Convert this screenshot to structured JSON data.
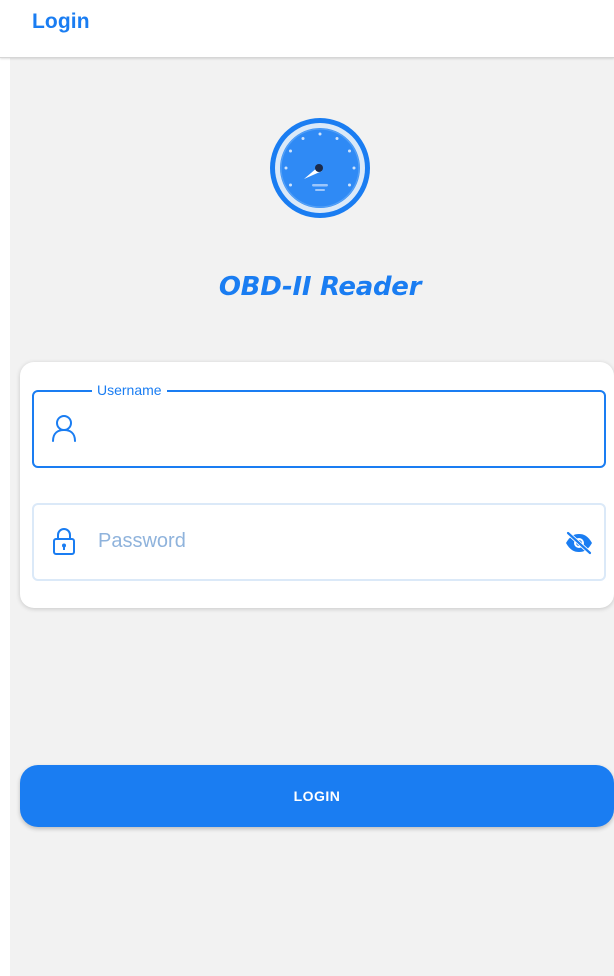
{
  "app_bar": {
    "title": "Login"
  },
  "brand": {
    "name": "OBD-II Reader",
    "logo_icon": "speedometer-gauge-icon"
  },
  "login_form": {
    "username": {
      "label": "Username",
      "value": "",
      "icon": "user-icon"
    },
    "password": {
      "placeholder": "Password",
      "value": "",
      "icon": "lock-icon",
      "visibility_toggle_icon": "eye-off-icon"
    },
    "submit_label": "LOGIN"
  },
  "colors": {
    "accent": "#1a7df2",
    "background": "#f2f2f2",
    "card": "#ffffff",
    "placeholder": "#8fb3dc"
  }
}
